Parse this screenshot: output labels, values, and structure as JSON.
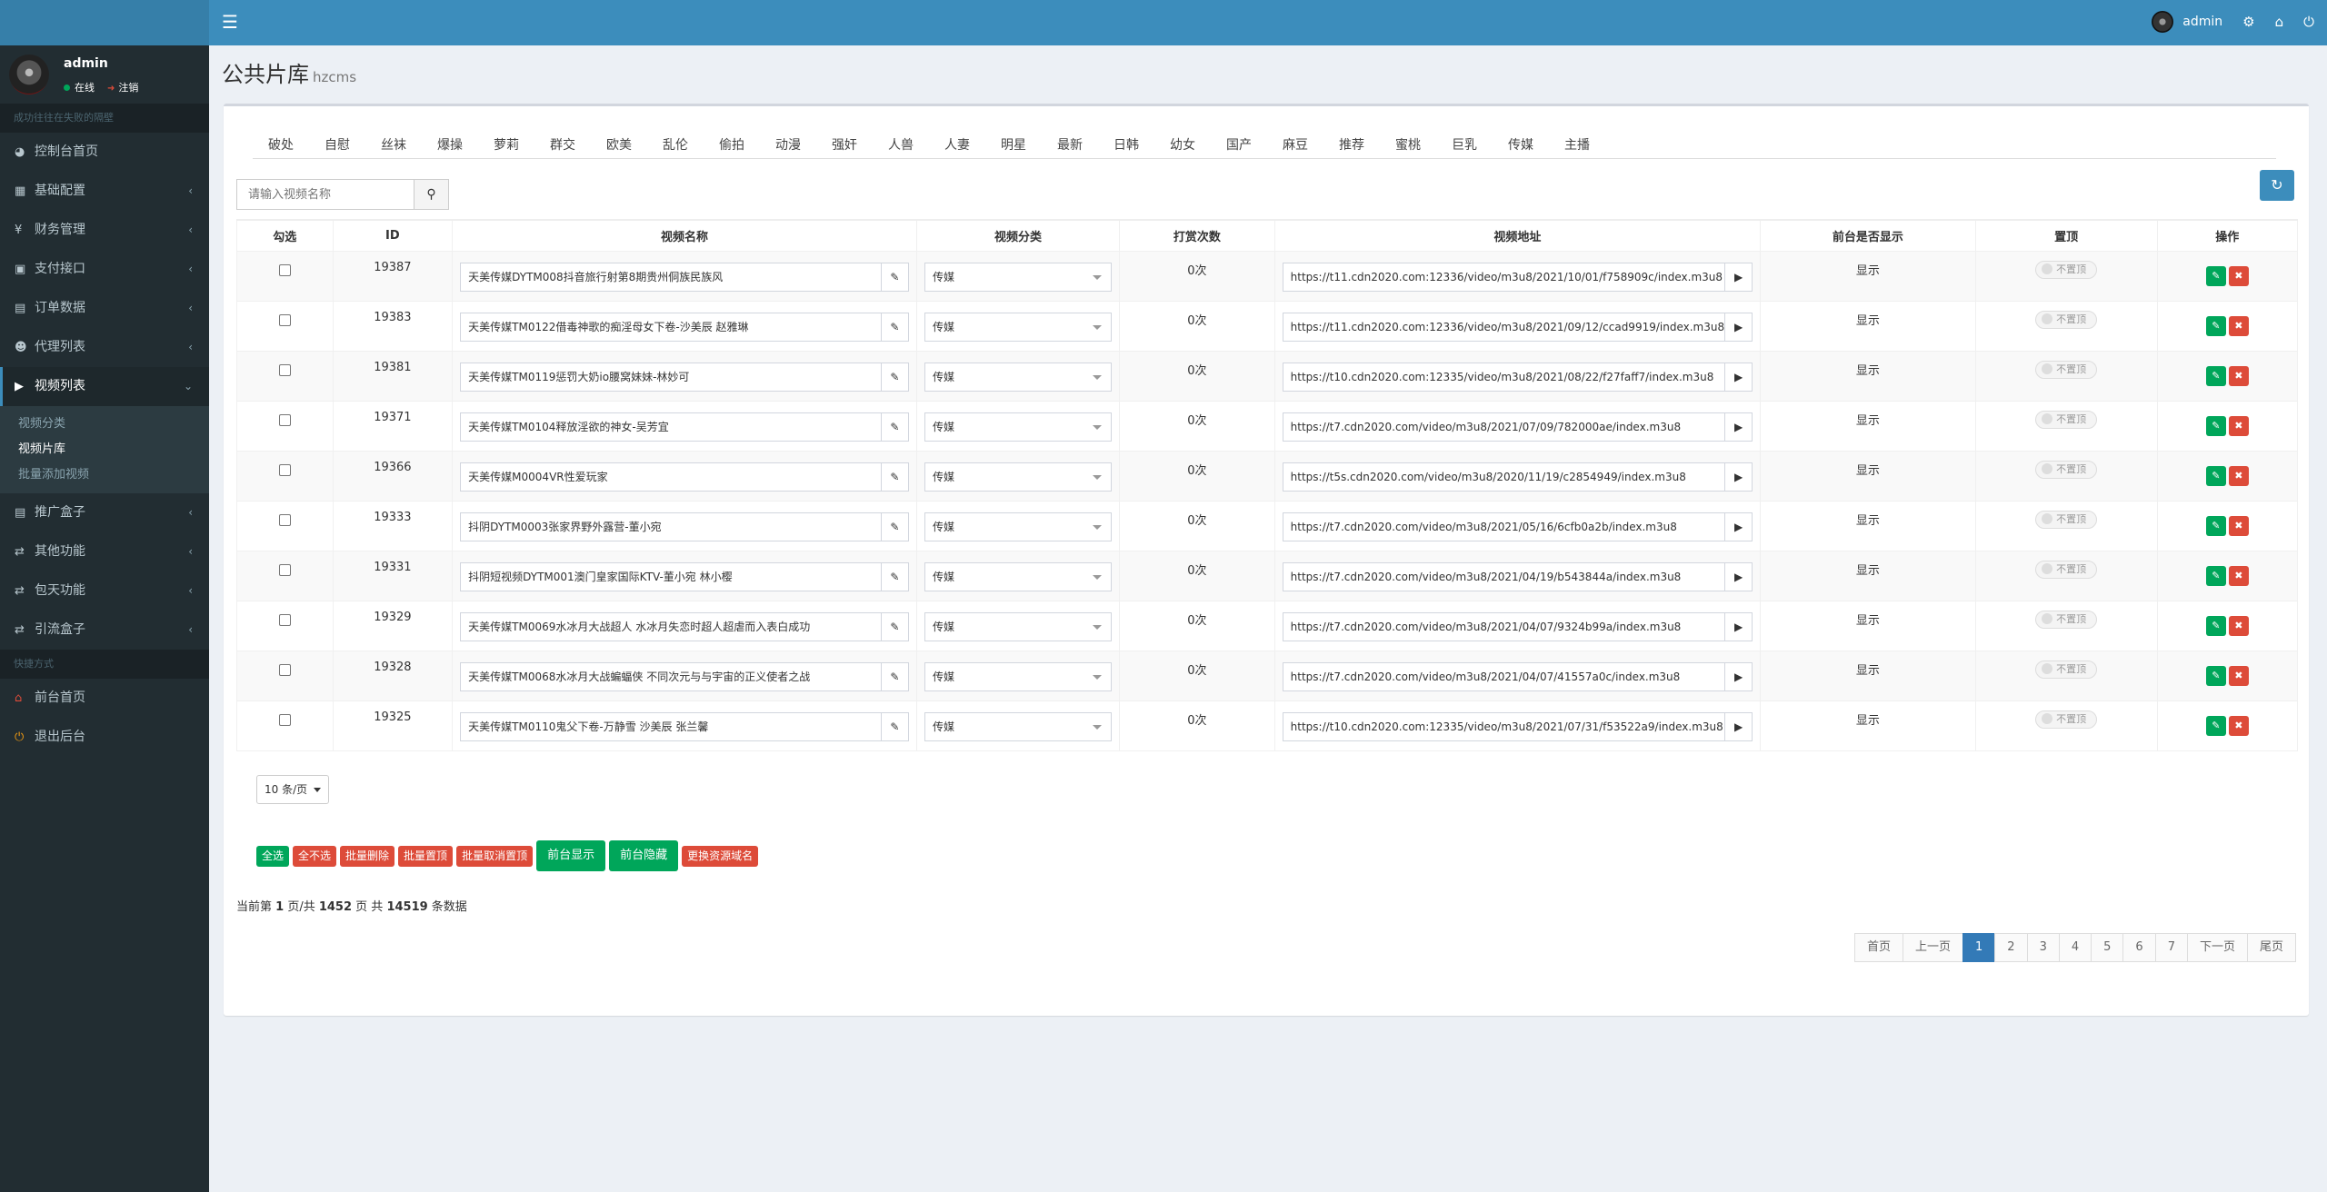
{
  "topbar": {
    "username": "admin"
  },
  "sidebar": {
    "username": "admin",
    "status_online": "在线",
    "status_logout": "注销",
    "section1": "成功往往在失败的隔壁",
    "section2": "快捷方式",
    "items": [
      {
        "label": "控制台首页",
        "icon": "dashboard-icon"
      },
      {
        "label": "基础配置",
        "icon": "grid-icon"
      },
      {
        "label": "财务管理",
        "icon": "yen-icon"
      },
      {
        "label": "支付接口",
        "icon": "credit-card-icon"
      },
      {
        "label": "订单数据",
        "icon": "chart-icon"
      },
      {
        "label": "代理列表",
        "icon": "users-icon"
      },
      {
        "label": "视频列表",
        "icon": "video-icon"
      },
      {
        "label": "推广盒子",
        "icon": "box-icon"
      },
      {
        "label": "其他功能",
        "icon": "retweet-icon"
      },
      {
        "label": "包天功能",
        "icon": "retweet-icon"
      },
      {
        "label": "引流盒子",
        "icon": "retweet-icon"
      }
    ],
    "submenu": [
      "视频分类",
      "视频片库",
      "批量添加视频"
    ],
    "shortcuts": [
      {
        "label": "前台首页",
        "icon": "home-icon"
      },
      {
        "label": "退出后台",
        "icon": "power-icon"
      }
    ]
  },
  "header": {
    "title": "公共片库",
    "subtitle": "hzcms"
  },
  "categories": [
    "破处",
    "自慰",
    "丝袜",
    "爆操",
    "萝莉",
    "群交",
    "欧美",
    "乱伦",
    "偷拍",
    "动漫",
    "强奸",
    "人兽",
    "人妻",
    "明星",
    "最新",
    "日韩",
    "幼女",
    "国产",
    "麻豆",
    "推荐",
    "蜜桃",
    "巨乳",
    "传媒",
    "主播"
  ],
  "search": {
    "placeholder": "请输入视频名称"
  },
  "table": {
    "headers": [
      "勾选",
      "ID",
      "视频名称",
      "视频分类",
      "打赏次数",
      "视频地址",
      "前台是否显示",
      "置顶",
      "操作"
    ],
    "rows": [
      {
        "id": "19387",
        "name": "天美传媒DYTM008抖音旅行射第8期贵州侗族民族风",
        "cat": "传媒",
        "count": "0次",
        "url": "https://t11.cdn2020.com:12336/video/m3u8/2021/10/01/f758909c/index.m3u8",
        "show": "显示",
        "top": "不置顶"
      },
      {
        "id": "19383",
        "name": "天美传媒TM0122借毒神歌的痴淫母女下卷-沙美辰 赵雅琳",
        "cat": "传媒",
        "count": "0次",
        "url": "https://t11.cdn2020.com:12336/video/m3u8/2021/09/12/ccad9919/index.m3u8",
        "show": "显示",
        "top": "不置顶"
      },
      {
        "id": "19381",
        "name": "天美传媒TM0119惩罚大奶io腰窝妹妹-林妙可",
        "cat": "传媒",
        "count": "0次",
        "url": "https://t10.cdn2020.com:12335/video/m3u8/2021/08/22/f27faff7/index.m3u8",
        "show": "显示",
        "top": "不置顶"
      },
      {
        "id": "19371",
        "name": "天美传媒TM0104释放淫欲的神女-吴芳宜",
        "cat": "传媒",
        "count": "0次",
        "url": "https://t7.cdn2020.com/video/m3u8/2021/07/09/782000ae/index.m3u8",
        "show": "显示",
        "top": "不置顶"
      },
      {
        "id": "19366",
        "name": "天美传媒M0004VR性爱玩家",
        "cat": "传媒",
        "count": "0次",
        "url": "https://t5s.cdn2020.com/video/m3u8/2020/11/19/c2854949/index.m3u8",
        "show": "显示",
        "top": "不置顶"
      },
      {
        "id": "19333",
        "name": "抖阴DYTM0003张家界野外露营-董小宛",
        "cat": "传媒",
        "count": "0次",
        "url": "https://t7.cdn2020.com/video/m3u8/2021/05/16/6cfb0a2b/index.m3u8",
        "show": "显示",
        "top": "不置顶"
      },
      {
        "id": "19331",
        "name": "抖阴短视频DYTM001澳门皇家国际KTV-董小宛 林小樱",
        "cat": "传媒",
        "count": "0次",
        "url": "https://t7.cdn2020.com/video/m3u8/2021/04/19/b543844a/index.m3u8",
        "show": "显示",
        "top": "不置顶"
      },
      {
        "id": "19329",
        "name": "天美传媒TM0069水冰月大战超人 水冰月失恋时超人超虐而入表白成功",
        "cat": "传媒",
        "count": "0次",
        "url": "https://t7.cdn2020.com/video/m3u8/2021/04/07/9324b99a/index.m3u8",
        "show": "显示",
        "top": "不置顶"
      },
      {
        "id": "19328",
        "name": "天美传媒TM0068水冰月大战蝙蝠侠 不同次元与与宇宙的正义使者之战",
        "cat": "传媒",
        "count": "0次",
        "url": "https://t7.cdn2020.com/video/m3u8/2021/04/07/41557a0c/index.m3u8",
        "show": "显示",
        "top": "不置顶"
      },
      {
        "id": "19325",
        "name": "天美传媒TM0110鬼父下卷-万静雪 沙美辰 张兰馨",
        "cat": "传媒",
        "count": "0次",
        "url": "https://t10.cdn2020.com:12335/video/m3u8/2021/07/31/f53522a9/index.m3u8",
        "show": "显示",
        "top": "不置顶"
      }
    ]
  },
  "pagesize": "10 条/页",
  "bulk": [
    "全选",
    "全不选",
    "批量删除",
    "批量置顶",
    "批量取消置顶",
    "前台显示",
    "前台隐藏",
    "更换资源域名"
  ],
  "summary": {
    "p1": "当前第 ",
    "page": "1",
    "p2": " 页/共 ",
    "pages": "1452",
    "p3": " 页 共 ",
    "total": "14519",
    "p4": " 条数据"
  },
  "pager": [
    "首页",
    "上一页",
    "1",
    "2",
    "3",
    "4",
    "5",
    "6",
    "7",
    "下一页",
    "尾页"
  ],
  "colors": {
    "primary": "#3c8dbc",
    "success": "#00a65a",
    "danger": "#dd4b39",
    "sidebar": "#222d32"
  }
}
